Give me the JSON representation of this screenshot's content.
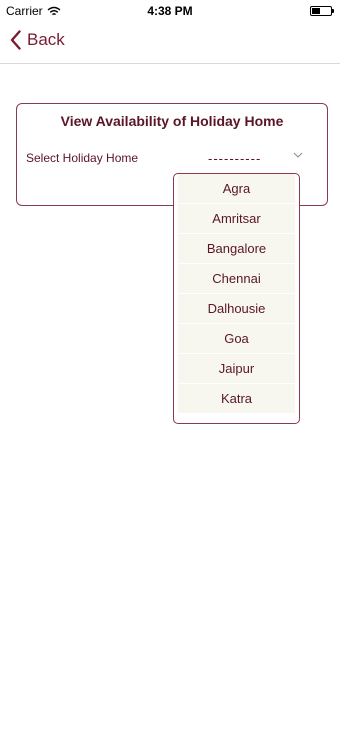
{
  "status_bar": {
    "carrier": "Carrier",
    "time": "4:38 PM",
    "wifi_icon": "wifi-icon",
    "battery_icon": "battery-icon"
  },
  "nav": {
    "back_label": "Back",
    "back_icon": "chevron-left-icon"
  },
  "card": {
    "title": "View Availability of Holiday Home",
    "select_label": "Select Holiday Home",
    "select_value": "----------",
    "select_icon": "chevron-down-icon"
  },
  "dropdown": {
    "options": [
      "Agra",
      "Amritsar",
      "Bangalore",
      "Chennai",
      "Dalhousie",
      "Goa",
      "Jaipur",
      "Katra"
    ]
  },
  "colors": {
    "accent": "#7a1b32",
    "text": "#5a1526",
    "option_bg": "#f7f7ef",
    "border": "#8a3a4c"
  }
}
